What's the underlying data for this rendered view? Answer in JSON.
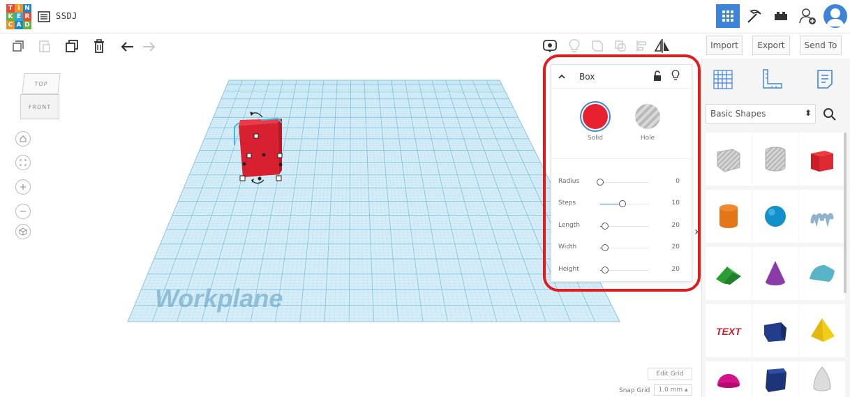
{
  "header": {
    "logo_letters": [
      "T",
      "I",
      "N",
      "K",
      "E",
      "R",
      "C",
      "A",
      "D"
    ],
    "design_name": "SSDJ"
  },
  "toolbar": {
    "import_label": "Import",
    "export_label": "Export",
    "send_to_label": "Send To"
  },
  "viewport": {
    "view_cube_top": "TOP",
    "view_cube_front": "FRONT",
    "workplane_label": "Workplane",
    "edit_grid_label": "Edit Grid",
    "snap_grid_label": "Snap Grid",
    "snap_grid_value": "1.0 mm ▴"
  },
  "inspector": {
    "shape_name": "Box",
    "solid_label": "Solid",
    "hole_label": "Hole",
    "solid_color": "#e82130",
    "params": [
      {
        "label": "Radius",
        "value": "0",
        "fraction": 0.0
      },
      {
        "label": "Steps",
        "value": "10",
        "fraction": 0.45
      },
      {
        "label": "Length",
        "value": "20",
        "fraction": 0.1
      },
      {
        "label": "Width",
        "value": "20",
        "fraction": 0.1
      },
      {
        "label": "Height",
        "value": "20",
        "fraction": 0.1
      }
    ]
  },
  "library": {
    "category": "Basic Shapes",
    "shapes": [
      "box-hole",
      "cylinder-hole",
      "box",
      "cylinder",
      "sphere",
      "scribble",
      "roof",
      "cone",
      "round-roof",
      "text",
      "polygon",
      "pyramid",
      "half-sphere",
      "hexagonal-prism",
      "paraboloid"
    ]
  },
  "colors": {
    "accent": "#3d83d9",
    "highlight": "#e21c1c",
    "grid": "#a9d8ee"
  }
}
